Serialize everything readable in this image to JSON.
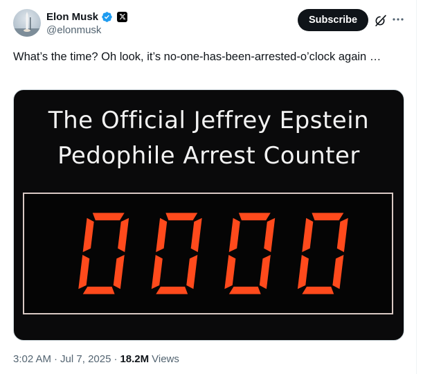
{
  "author": {
    "name": "Elon Musk",
    "handle": "@elonmusk"
  },
  "actions": {
    "subscribe_label": "Subscribe"
  },
  "icons": {
    "verified": "verified-badge-icon",
    "affiliate": "x-logo-icon",
    "grok": "grok-icon",
    "more": "more-icon"
  },
  "tweet": {
    "text": "What’s the time? Oh look, it’s no-one-has-been-arrested-o’clock again …"
  },
  "media": {
    "title_line1": "The Official Jeffrey Epstein",
    "title_line2": "Pedophile Arrest Counter",
    "counter_value": "0000",
    "digit_color": "#ff4a1c"
  },
  "meta": {
    "time": "3:02 AM",
    "date": "Jul 7, 2025",
    "views_count": "18.2M",
    "views_label": "Views"
  },
  "colors": {
    "accent": "#1d9bf0",
    "text": "#0f1419",
    "secondary": "#536471"
  }
}
